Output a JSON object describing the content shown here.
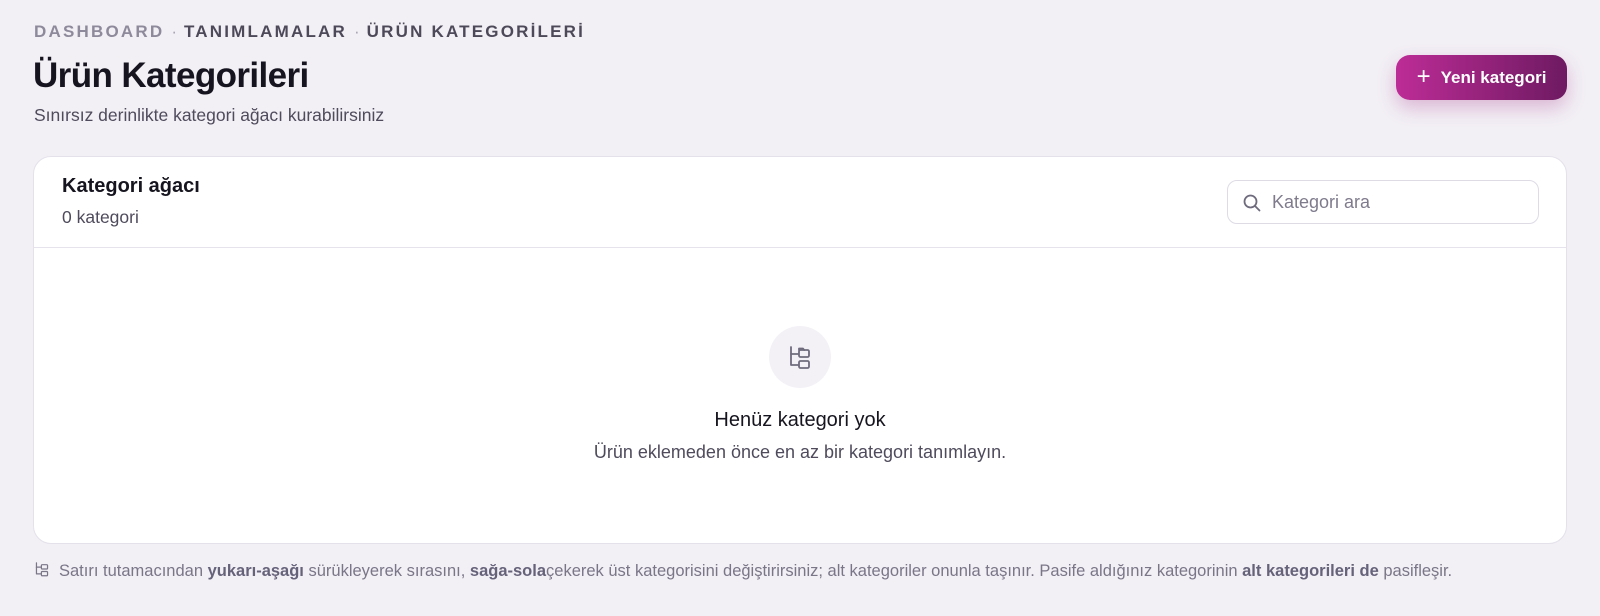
{
  "breadcrumb": {
    "items": [
      "DASHBOARD",
      "TANIMLAMALAR",
      "ÜRÜN KATEGORİLERİ"
    ],
    "separator": "·"
  },
  "header": {
    "title": "Ürün Kategorileri",
    "subtitle": "Sınırsız derinlikte kategori ağacı kurabilirsiniz",
    "new_button_label": "Yeni kategori",
    "new_button_icon": "plus-icon"
  },
  "card": {
    "title": "Kategori ağacı",
    "count_label": "0 kategori",
    "search": {
      "placeholder": "Kategori ara",
      "value": "",
      "icon": "search-icon"
    },
    "empty_state": {
      "icon": "tree-structure-icon",
      "title": "Henüz kategori yok",
      "description": "Ürün eklemeden önce en az bir kategori tanımlayın."
    }
  },
  "footer": {
    "icon": "tree-structure-icon",
    "parts": [
      "Satırı tutamacından ",
      "yukarı-aşağı",
      " sürükleyerek sırasını, ",
      "sağa-sola",
      "çekerek üst kategorisini değiştirirsiniz; alt kategoriler onunla taşınır. Pasife aldığınız kategorinin ",
      "alt kategorileri de",
      " pasifleşir."
    ]
  },
  "colors": {
    "accent_start": "#bd2c96",
    "accent_end": "#6e1a62",
    "page_bg": "#f2eff5",
    "card_bg": "#ffffff"
  }
}
